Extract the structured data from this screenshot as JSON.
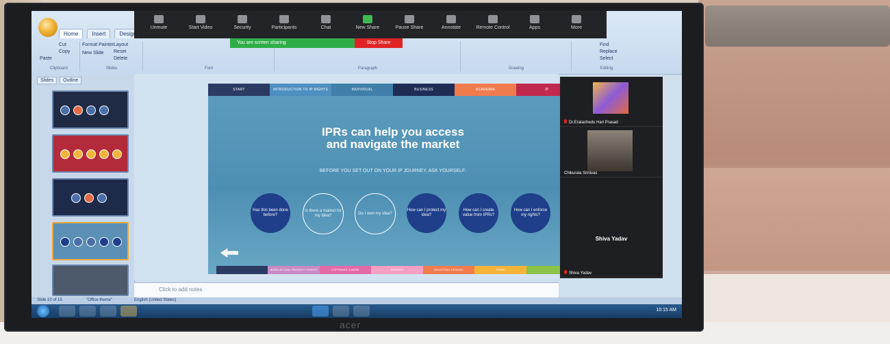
{
  "ppt": {
    "tabs": [
      "Home",
      "Insert",
      "Design"
    ],
    "clipboard": {
      "cut": "Cut",
      "copy": "Copy",
      "painter": "Format Painter",
      "paste": "Paste",
      "new_slide": "New Slide",
      "layout": "Layout",
      "reset": "Reset",
      "delete": "Delete",
      "group_label": "Clipboard",
      "slides_label": "Slides"
    },
    "group_labels": {
      "font": "Font",
      "paragraph": "Paragraph",
      "drawing": "Drawing",
      "editing": "Editing"
    },
    "editing": {
      "find": "Find",
      "replace": "Replace",
      "select": "Select"
    },
    "panel_tabs": [
      "Slides",
      "Outline"
    ],
    "notes_placeholder": "Click to add notes",
    "status": {
      "slide": "Slide 10 of 15",
      "theme": "\"Office theme\"",
      "lang": "English (United States)"
    }
  },
  "zoom": {
    "tools": [
      {
        "label": "Unmute",
        "icon": "mic-icon"
      },
      {
        "label": "Start Video",
        "icon": "video-icon"
      },
      {
        "label": "Security",
        "icon": "shield-icon"
      },
      {
        "label": "Participants",
        "icon": "participants-icon"
      },
      {
        "label": "Chat",
        "icon": "chat-icon"
      },
      {
        "label": "New Share",
        "icon": "share-icon"
      },
      {
        "label": "Pause Share",
        "icon": "pause-icon"
      },
      {
        "label": "Annotate",
        "icon": "pen-icon"
      },
      {
        "label": "Remote Control",
        "icon": "mouse-icon"
      },
      {
        "label": "Apps",
        "icon": "apps-icon"
      },
      {
        "label": "More",
        "icon": "more-icon"
      }
    ],
    "share_banner": "You are screen sharing",
    "stop_share": "Stop Share",
    "participants": [
      {
        "name": "Dr.Eratachedu Hari Prasad"
      },
      {
        "name": "Chikurala Srinivas"
      },
      {
        "name": "Shiva Yadav"
      }
    ],
    "center_name": "Shiva Yadav"
  },
  "slide": {
    "nav": [
      "START",
      "INTRODUCTION TO IP RIGHTS",
      "INDIVIDUAL",
      "BUSINESS",
      "ACADEMIA",
      "IP"
    ],
    "nav_colors": [
      "#2b3b63",
      "#4f8fc0",
      "#3f7fa9",
      "#1f2d56",
      "#f07c4e",
      "#c2294e"
    ],
    "title_line1": "IPRs can help you access",
    "title_line2": "and navigate the market",
    "subtitle": "BEFORE YOU SET OUT ON YOUR IP JOURNEY, ASK YOURSELF:",
    "questions": [
      {
        "text": "Has this been done before?",
        "style": "solid"
      },
      {
        "text": "Is there a market for my idea?",
        "style": "outline"
      },
      {
        "text": "Do I own my idea?",
        "style": "outline"
      },
      {
        "text": "How can I protect my idea?",
        "style": "solid"
      },
      {
        "text": "How can I create value from IPRs?",
        "style": "solid"
      },
      {
        "text": "How can I enforce my rights?",
        "style": "solid"
      }
    ],
    "bottom_nav": [
      "",
      "INTELLECTUAL PROPERTY RIGHTS",
      "COPYRIGHT & MORE",
      "PATENTS",
      "INDUSTRIAL DESIGNS",
      "TRADE",
      ""
    ],
    "bottom_colors": [
      "#2b3b63",
      "#c98ac4",
      "#e36aa8",
      "#f3a0c2",
      "#f07c4e",
      "#f4b43a",
      "#8bc34a"
    ]
  },
  "taskbar": {
    "clock": "10:15 AM"
  },
  "monitor": {
    "brand": "acer"
  }
}
